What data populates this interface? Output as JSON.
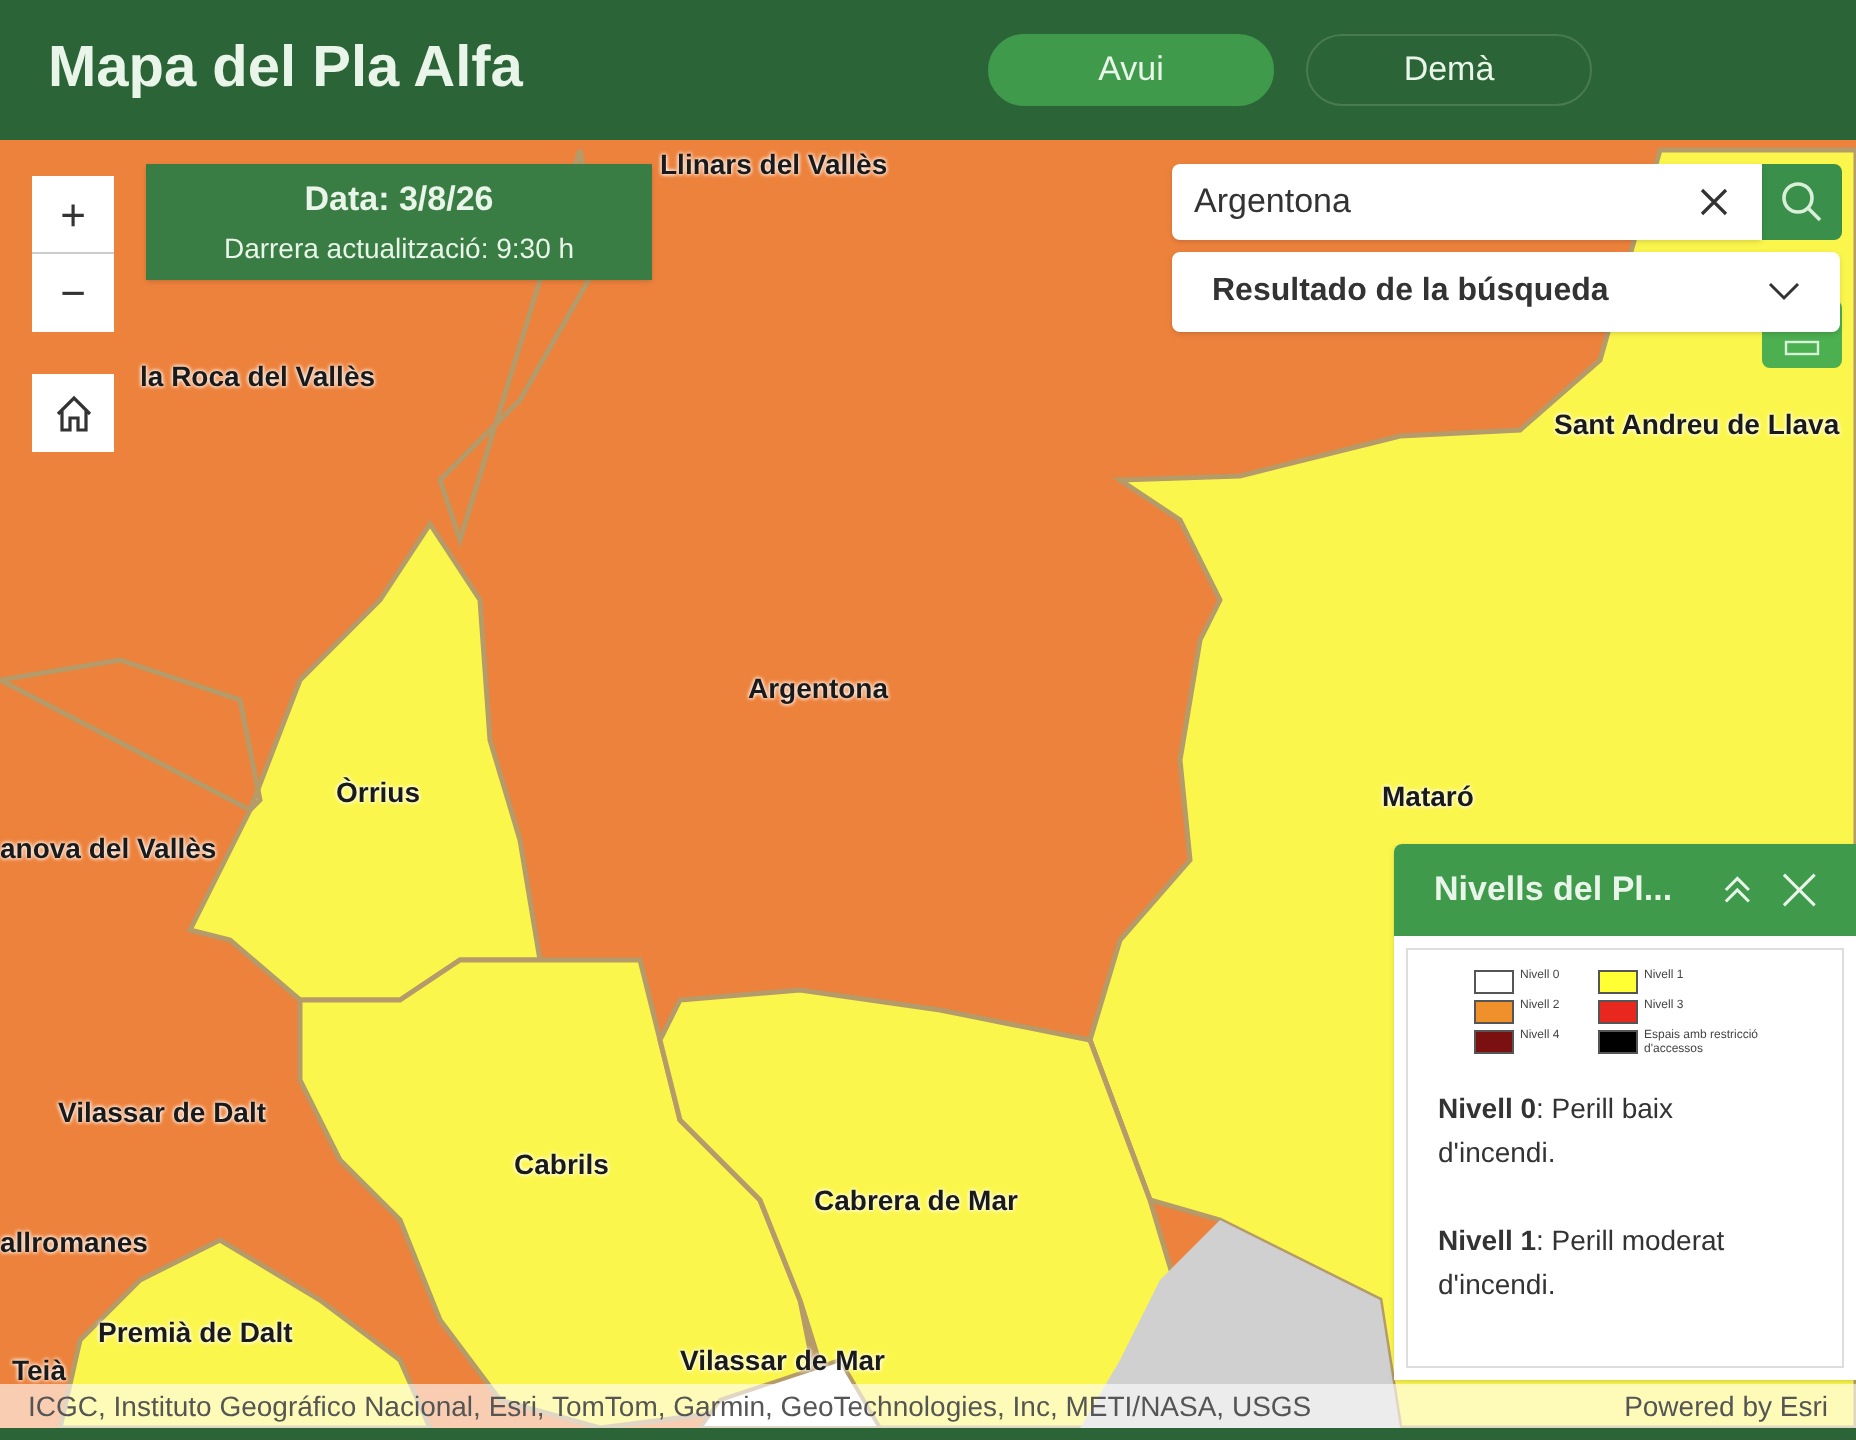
{
  "header": {
    "title": "Mapa del Pla Alfa"
  },
  "tabs": [
    {
      "label": "Avui",
      "selected": true
    },
    {
      "label": "Demà",
      "selected": false
    }
  ],
  "zoom_controls": {
    "zoom_in": "+",
    "zoom_out": "−"
  },
  "date_card": {
    "date": "Data: 3/8/26",
    "updated": "Darrera actualització: 9:30 h"
  },
  "search": {
    "value": "Argentona",
    "results_label": "Resultado de la búsqueda"
  },
  "map_labels": [
    {
      "text": "Llinars del Vallès"
    },
    {
      "text": "la Roca del Vallès"
    },
    {
      "text": "Sant Andreu de Llava"
    },
    {
      "text": "Argentona"
    },
    {
      "text": "Òrrius"
    },
    {
      "text": "anova del Vallès"
    },
    {
      "text": "Mataró"
    },
    {
      "text": "Vilassar de Dalt"
    },
    {
      "text": "Cabrils"
    },
    {
      "text": "Cabrera de Mar"
    },
    {
      "text": "allromanes"
    },
    {
      "text": "Premià de Dalt"
    },
    {
      "text": "Teià"
    },
    {
      "text": "Vilassar de Mar"
    }
  ],
  "legend_panel": {
    "title": "Nivells del Pl...",
    "items": [
      {
        "label": "Nivell 0",
        "color": "#ffffff"
      },
      {
        "label": "Nivell 1",
        "color": "#ffff33"
      },
      {
        "label": "Nivell 2",
        "color": "#f0902a"
      },
      {
        "label": "Nivell 3",
        "color": "#e8281e"
      },
      {
        "label": "Nivell 4",
        "color": "#7a1010"
      },
      {
        "label": "Espais amb restricció d'accessos",
        "color": "#000000"
      }
    ],
    "descriptions": [
      "**Nivell 0**: Perill baix d'incendi.",
      "**Nivell 1**: Perill moderat d'incendi."
    ]
  },
  "attribution": {
    "sources": "ICGC, Instituto Geográfico Nacional, Esri, TomTom, Garmin, GeoTechnologies, Inc, METI/NASA, USGS",
    "powered_by": "Powered by Esri"
  }
}
